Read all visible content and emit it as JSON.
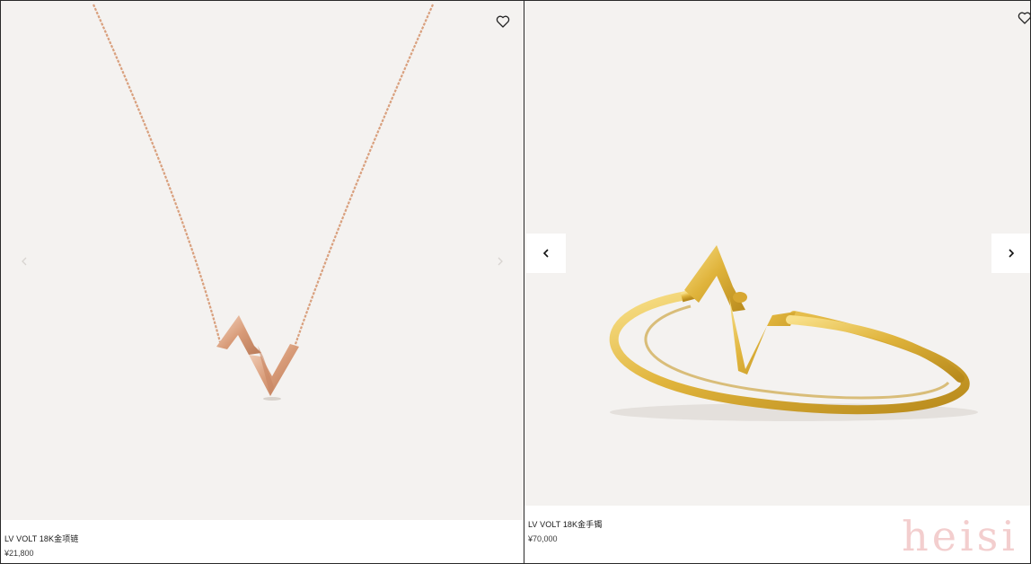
{
  "products": [
    {
      "name": "LV VOLT 18K金项链",
      "price": "¥21,800",
      "favorite_icon": "heart-outline-icon",
      "prev_icon": "chevron-left-icon",
      "next_icon": "chevron-right-icon",
      "metal_color": "#d9a07e"
    },
    {
      "name": "LV VOLT 18K金手镯",
      "price": "¥70,000",
      "favorite_icon": "heart-outline-icon",
      "prev_icon": "chevron-left-icon",
      "next_icon": "chevron-right-icon",
      "metal_color": "#e0b43c"
    }
  ],
  "watermark": "heisi",
  "colors": {
    "image_background": "#f4f2f0",
    "border": "#2a2a2a",
    "text": "#1a1a1a"
  }
}
